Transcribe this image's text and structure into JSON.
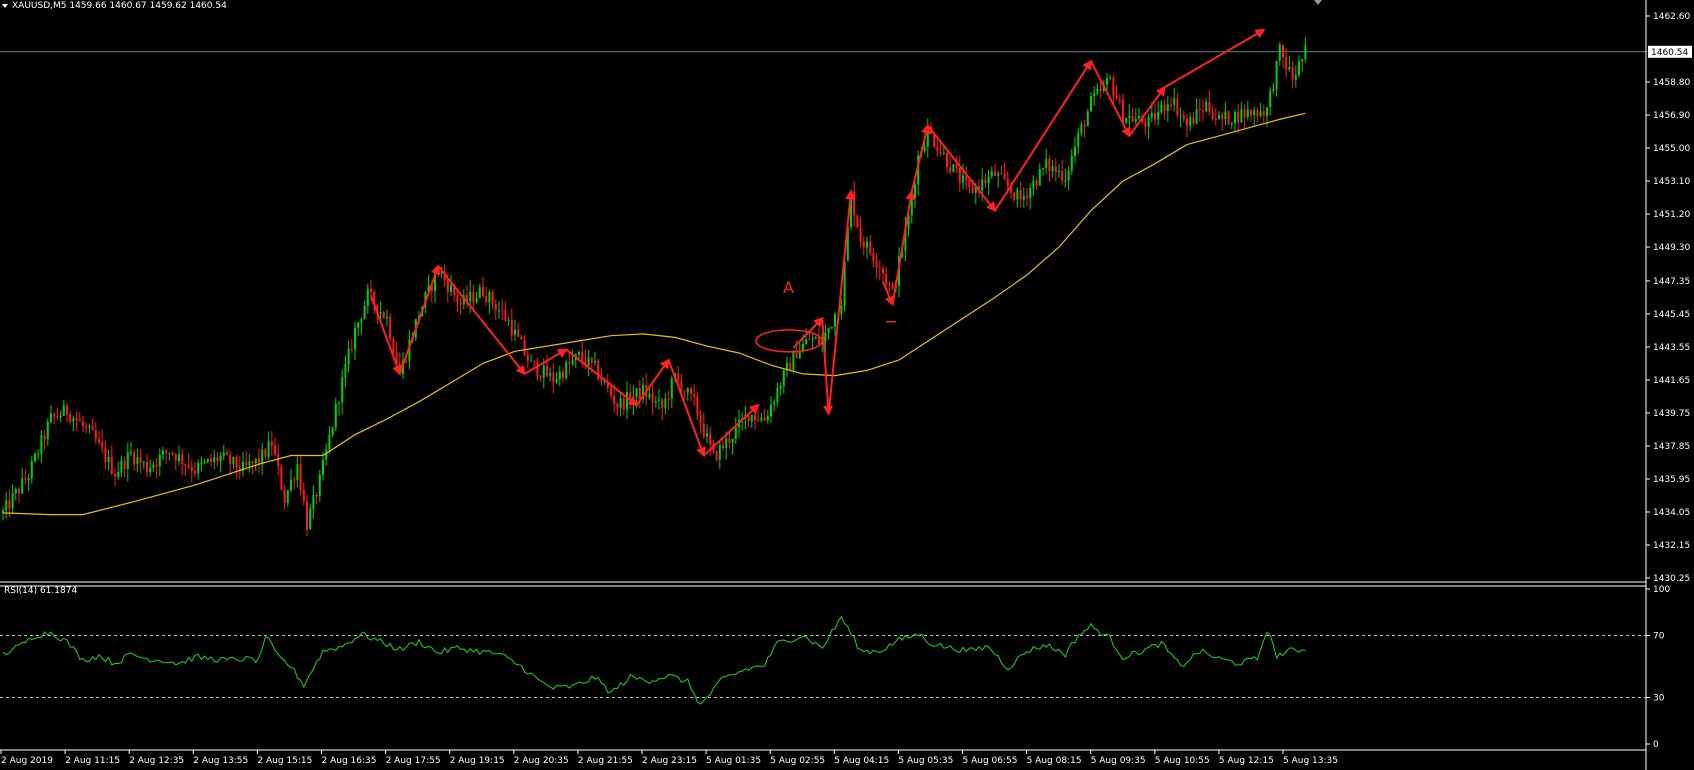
{
  "header": {
    "symbol_line": "XAUUSD,M5  1459.66 1460.67 1459.62 1460.54",
    "rsi_line": "RSI(14) 61.1874"
  },
  "colors": {
    "background": "#000000",
    "bull": "#00d200",
    "bear": "#ff1a1a",
    "ma": "#e8c200",
    "rsi": "#1fd31f",
    "annotation": "#ff2020",
    "axis": "#ffffff",
    "price_line": "#5a7d9a"
  },
  "chart_data": [
    {
      "type": "candlestick",
      "title": "XAUUSD,M5",
      "ylim": [
        1430.25,
        1463.5
      ],
      "y_ticks": [
        1462.6,
        1458.8,
        1456.9,
        1455.0,
        1453.1,
        1451.2,
        1449.3,
        1447.35,
        1445.45,
        1443.55,
        1441.65,
        1439.75,
        1437.85,
        1435.95,
        1434.05,
        1432.15,
        1430.25
      ],
      "y_tick_labels": [
        "1462.60",
        "1458.80",
        "1456.90",
        "1455.00",
        "1453.10",
        "1451.20",
        "1449.30",
        "1447.35",
        "1445.45",
        "1443.55",
        "1441.65",
        "1439.75",
        "1437.85",
        "1435.95",
        "1434.05",
        "1432.15",
        "1430.25"
      ],
      "last_price": 1460.54,
      "last_price_label": "1460.54",
      "x_labels": [
        "2 Aug 2019",
        "2 Aug 11:15",
        "2 Aug 12:35",
        "2 Aug 13:55",
        "2 Aug 15:15",
        "2 Aug 16:35",
        "2 Aug 17:55",
        "2 Aug 19:15",
        "2 Aug 20:35",
        "2 Aug 21:55",
        "2 Aug 23:15",
        "5 Aug 01:35",
        "5 Aug 02:55",
        "5 Aug 04:15",
        "5 Aug 05:35",
        "5 Aug 06:55",
        "5 Aug 08:15",
        "5 Aug 09:35",
        "5 Aug 10:55",
        "5 Aug 12:15",
        "5 Aug 13:35"
      ],
      "close_path": [
        [
          0,
          1434.0
        ],
        [
          8,
          1436.2
        ],
        [
          15,
          1439.4
        ],
        [
          20,
          1439.9
        ],
        [
          28,
          1438.4
        ],
        [
          35,
          1436.3
        ],
        [
          40,
          1437.4
        ],
        [
          45,
          1436.6
        ],
        [
          52,
          1437.6
        ],
        [
          60,
          1436.5
        ],
        [
          68,
          1437.2
        ],
        [
          75,
          1436.5
        ],
        [
          80,
          1437.0
        ],
        [
          84,
          1438.0
        ],
        [
          88,
          1434.8
        ],
        [
          92,
          1436.8
        ],
        [
          95,
          1433.4
        ],
        [
          99,
          1435.8
        ],
        [
          105,
          1440.8
        ],
        [
          110,
          1444.5
        ],
        [
          114,
          1446.5
        ],
        [
          120,
          1445.2
        ],
        [
          124,
          1442.0
        ],
        [
          130,
          1445.5
        ],
        [
          136,
          1448.0
        ],
        [
          143,
          1446.0
        ],
        [
          150,
          1446.8
        ],
        [
          158,
          1445.0
        ],
        [
          165,
          1442.5
        ],
        [
          172,
          1441.7
        ],
        [
          180,
          1443.0
        ],
        [
          185,
          1442.3
        ],
        [
          192,
          1440.2
        ],
        [
          200,
          1441.0
        ],
        [
          206,
          1440.0
        ],
        [
          210,
          1441.8
        ],
        [
          216,
          1440.3
        ],
        [
          222,
          1437.2
        ],
        [
          228,
          1438.5
        ],
        [
          233,
          1439.7
        ],
        [
          238,
          1439.4
        ],
        [
          243,
          1441.5
        ],
        [
          248,
          1443.3
        ],
        [
          252,
          1444.0
        ],
        [
          256,
          1443.8
        ],
        [
          262,
          1446.3
        ],
        [
          265,
          1452.3
        ],
        [
          268,
          1449.8
        ],
        [
          274,
          1448.3
        ],
        [
          278,
          1446.6
        ],
        [
          283,
          1451.0
        ],
        [
          286,
          1454.5
        ],
        [
          289,
          1456.0
        ],
        [
          296,
          1454.0
        ],
        [
          302,
          1452.5
        ],
        [
          310,
          1453.5
        ],
        [
          318,
          1452.0
        ],
        [
          326,
          1454.0
        ],
        [
          332,
          1453.4
        ],
        [
          336,
          1455.6
        ],
        [
          340,
          1457.6
        ],
        [
          346,
          1458.9
        ],
        [
          350,
          1456.9
        ],
        [
          358,
          1456.4
        ],
        [
          365,
          1457.9
        ],
        [
          370,
          1456.3
        ],
        [
          376,
          1457.5
        ],
        [
          380,
          1456.6
        ],
        [
          388,
          1457.0
        ],
        [
          395,
          1457.2
        ],
        [
          399,
          1460.5
        ],
        [
          403,
          1459.0
        ],
        [
          407,
          1460.54
        ]
      ],
      "ma": [
        [
          0,
          1434.0
        ],
        [
          15,
          1433.9
        ],
        [
          25,
          1433.9
        ],
        [
          40,
          1434.6
        ],
        [
          60,
          1435.6
        ],
        [
          80,
          1436.8
        ],
        [
          90,
          1437.3
        ],
        [
          100,
          1437.3
        ],
        [
          110,
          1438.5
        ],
        [
          120,
          1439.4
        ],
        [
          130,
          1440.4
        ],
        [
          140,
          1441.5
        ],
        [
          150,
          1442.6
        ],
        [
          160,
          1443.3
        ],
        [
          170,
          1443.6
        ],
        [
          180,
          1443.9
        ],
        [
          190,
          1444.2
        ],
        [
          200,
          1444.3
        ],
        [
          210,
          1444.1
        ],
        [
          220,
          1443.6
        ],
        [
          230,
          1443.2
        ],
        [
          240,
          1442.5
        ],
        [
          250,
          1442.0
        ],
        [
          260,
          1441.9
        ],
        [
          270,
          1442.2
        ],
        [
          280,
          1442.8
        ],
        [
          290,
          1444.0
        ],
        [
          300,
          1445.2
        ],
        [
          310,
          1446.4
        ],
        [
          320,
          1447.7
        ],
        [
          330,
          1449.3
        ],
        [
          340,
          1451.4
        ],
        [
          350,
          1453.1
        ],
        [
          360,
          1454.1
        ],
        [
          370,
          1455.2
        ],
        [
          380,
          1455.7
        ],
        [
          390,
          1456.2
        ],
        [
          400,
          1456.7
        ],
        [
          407,
          1457.0
        ]
      ],
      "zigzags": [
        [
          [
            115,
            1446.5
          ],
          [
            124,
            1442.0
          ],
          [
            136,
            1448.2
          ],
          [
            163,
            1442.0
          ],
          [
            176,
            1443.4
          ],
          [
            198,
            1440.2
          ],
          [
            208,
            1442.8
          ],
          [
            219,
            1437.3
          ],
          [
            236,
            1440.2
          ]
        ],
        [
          [
            247,
            1443.5
          ],
          [
            256,
            1445.2
          ],
          [
            258,
            1439.7
          ],
          [
            265,
            1452.5
          ]
        ],
        [
          [
            275,
            1447.3
          ],
          [
            278,
            1446.0
          ],
          [
            284,
            1452.5
          ],
          [
            289,
            1456.3
          ],
          [
            310,
            1451.4
          ],
          [
            340,
            1460.0
          ],
          [
            352,
            1455.7
          ],
          [
            363,
            1458.5
          ],
          [
            394,
            1461.8
          ]
        ]
      ],
      "annotations": [
        {
          "text": "A",
          "x": 245,
          "y": 1446.3
        }
      ]
    },
    {
      "type": "line",
      "title": "RSI(14) 61.1874",
      "ylim": [
        0,
        100
      ],
      "y_ticks": [
        0,
        30,
        70,
        100
      ],
      "y_tick_labels": [
        "0",
        "30",
        "70",
        "100"
      ],
      "levels": [
        30,
        70
      ],
      "series": [
        {
          "name": "RSI(14)",
          "points": [
            [
              0,
              58
            ],
            [
              5,
              63
            ],
            [
              10,
              70
            ],
            [
              15,
              72
            ],
            [
              20,
              66
            ],
            [
              25,
              54
            ],
            [
              30,
              57
            ],
            [
              35,
              52
            ],
            [
              40,
              58
            ],
            [
              45,
              55
            ],
            [
              50,
              54
            ],
            [
              55,
              52
            ],
            [
              60,
              56
            ],
            [
              65,
              55
            ],
            [
              70,
              54
            ],
            [
              75,
              55
            ],
            [
              80,
              54
            ],
            [
              82,
              70
            ],
            [
              86,
              56
            ],
            [
              90,
              50
            ],
            [
              94,
              38
            ],
            [
              100,
              60
            ],
            [
              106,
              63
            ],
            [
              112,
              71
            ],
            [
              118,
              66
            ],
            [
              124,
              61
            ],
            [
              130,
              66
            ],
            [
              136,
              59
            ],
            [
              142,
              62
            ],
            [
              148,
              60
            ],
            [
              155,
              58
            ],
            [
              162,
              50
            ],
            [
              168,
              40
            ],
            [
              172,
              36
            ],
            [
              178,
              37
            ],
            [
              185,
              43
            ],
            [
              190,
              33
            ],
            [
              196,
              43
            ],
            [
              202,
              41
            ],
            [
              208,
              44
            ],
            [
              214,
              40
            ],
            [
              218,
              25
            ],
            [
              225,
              42
            ],
            [
              232,
              48
            ],
            [
              238,
              51
            ],
            [
              242,
              65
            ],
            [
              250,
              70
            ],
            [
              256,
              62
            ],
            [
              262,
              82
            ],
            [
              268,
              60
            ],
            [
              274,
              60
            ],
            [
              280,
              67
            ],
            [
              286,
              71
            ],
            [
              290,
              65
            ],
            [
              296,
              62
            ],
            [
              302,
              60
            ],
            [
              308,
              63
            ],
            [
              314,
              49
            ],
            [
              320,
              60
            ],
            [
              326,
              64
            ],
            [
              332,
              58
            ],
            [
              336,
              70
            ],
            [
              340,
              76
            ],
            [
              346,
              68
            ],
            [
              350,
              56
            ],
            [
              356,
              60
            ],
            [
              362,
              65
            ],
            [
              368,
              50
            ],
            [
              374,
              60
            ],
            [
              380,
              55
            ],
            [
              386,
              52
            ],
            [
              392,
              55
            ],
            [
              395,
              74
            ],
            [
              398,
              57
            ],
            [
              402,
              60
            ],
            [
              407,
              61.2
            ]
          ]
        }
      ]
    }
  ]
}
